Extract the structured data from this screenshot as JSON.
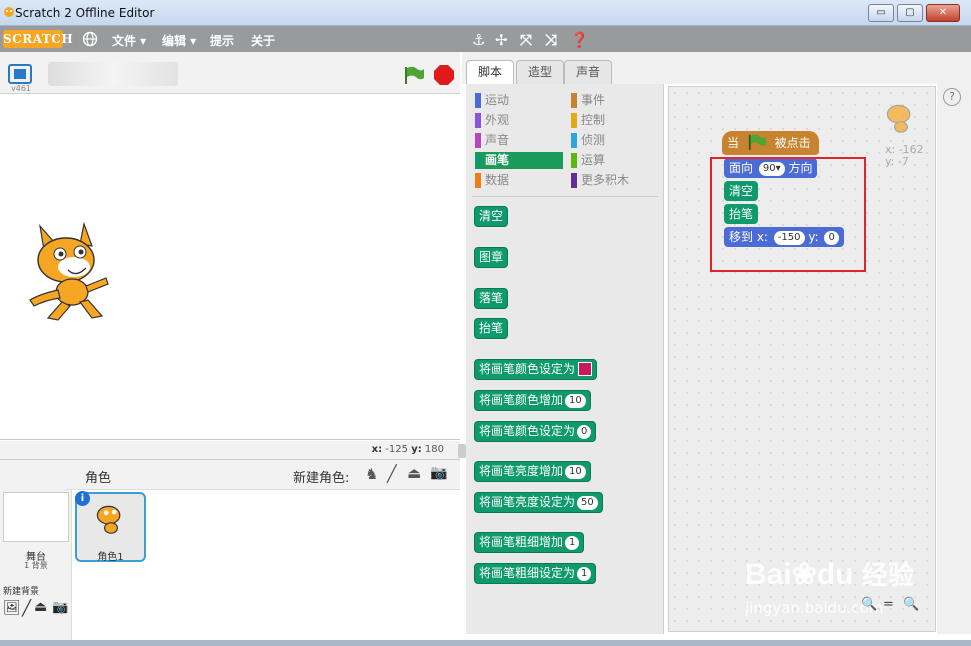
{
  "window": {
    "title": "Scratch 2 Offline Editor",
    "buttons": [
      "▭",
      "▢",
      "✕"
    ]
  },
  "menubar": {
    "logo": "SCRATCH",
    "items": [
      "文件 ▾",
      "编辑 ▾",
      "提示",
      "关于"
    ]
  },
  "toolbar": {
    "icons": [
      "stamp-icon",
      "move-icon",
      "grow-icon",
      "shrink-icon",
      "help-icon"
    ]
  },
  "stage": {
    "version": "v461",
    "coords": {
      "x_label": "x:",
      "x": "-125",
      "y_label": "y:",
      "y": "180"
    }
  },
  "sprites": {
    "header": "角色",
    "new_sprite_label": "新建角色:",
    "stage_label": "舞台",
    "backdrop_count": "1 背景",
    "new_backdrop_label": "新建背景",
    "sprite_list": [
      {
        "name": "角色1"
      }
    ]
  },
  "tabs": [
    "脚本",
    "造型",
    "声音"
  ],
  "categories": [
    {
      "label": "运动",
      "color": "#4a6cd4",
      "selected": false
    },
    {
      "label": "外观",
      "color": "#8a55d7",
      "selected": false
    },
    {
      "label": "声音",
      "color": "#bb42c3",
      "selected": false
    },
    {
      "label": "画笔",
      "color": "#0e9a6c",
      "selected": true
    },
    {
      "label": "数据",
      "color": "#ee7d16",
      "selected": false
    },
    {
      "label": "事件",
      "color": "#c88330",
      "selected": false
    },
    {
      "label": "控制",
      "color": "#e1a91a",
      "selected": false
    },
    {
      "label": "侦测",
      "color": "#2ca5e2",
      "selected": false
    },
    {
      "label": "运算",
      "color": "#5cb712",
      "selected": false
    },
    {
      "label": "更多积木",
      "color": "#632d99",
      "selected": false
    }
  ],
  "pen_blocks": [
    {
      "label": "清空",
      "value": ""
    },
    {
      "label": "图章",
      "value": ""
    },
    {
      "label": "落笔",
      "value": ""
    },
    {
      "label": "抬笔",
      "value": ""
    },
    {
      "label": "将画笔颜色设定为",
      "value": "",
      "color": "#c8195a"
    },
    {
      "label": "将画笔颜色增加",
      "value": "10"
    },
    {
      "label": "将画笔颜色设定为",
      "value": "0"
    },
    {
      "label": "将画笔亮度增加",
      "value": "10"
    },
    {
      "label": "将画笔亮度设定为",
      "value": "50"
    },
    {
      "label": "将画笔粗细增加",
      "value": "1"
    },
    {
      "label": "将画笔粗细设定为",
      "value": "1"
    }
  ],
  "script": {
    "hat": {
      "prefix": "当",
      "suffix": "被点击"
    },
    "point": {
      "prefix": "面向",
      "value": "90",
      "suffix": "方向"
    },
    "clear": "清空",
    "penup": "抬笔",
    "goto": {
      "prefix": "移到 x:",
      "x": "-150",
      "y_label": "y:",
      "y": "0"
    },
    "sprite_x": "x: -162",
    "sprite_y": "y: -7"
  },
  "watermark": {
    "brand": "Bai",
    "brand2": "du",
    "site": "经验",
    "url": "jingyan.baidu.com"
  },
  "colors": {
    "pen": "#0e9a6c",
    "motion": "#4a6cd4",
    "events": "#c88330",
    "highlight": "#e0242b"
  }
}
